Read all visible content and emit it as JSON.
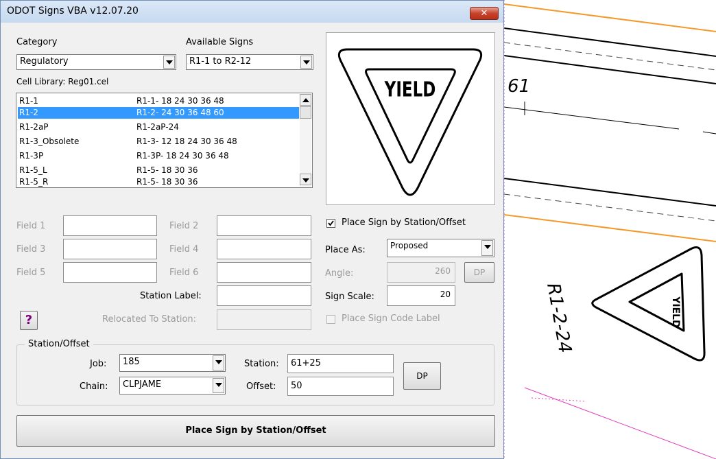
{
  "window": {
    "title": "ODOT Signs VBA  v12.07.20",
    "close_label": "✕"
  },
  "category": {
    "label": "Category",
    "value": "Regulatory"
  },
  "available_signs": {
    "label": "Available Signs",
    "value": "R1-1 to R2-12"
  },
  "cell_library": "Cell Library:  Reg01.cel",
  "sign_list": [
    {
      "code": "R1-1",
      "sizes": "R1-1- 18 24 30 36 48",
      "selected": false
    },
    {
      "code": "R1-2",
      "sizes": "R1-2- 24 30 36 48 60",
      "selected": true
    },
    {
      "code": "R1-2aP",
      "sizes": "R1-2aP-24",
      "selected": false
    },
    {
      "code": "R1-3_Obsolete",
      "sizes": "R1-3- 12 18 24 30 36 48",
      "selected": false
    },
    {
      "code": "R1-3P",
      "sizes": "R1-3P- 18 24 30 36 48",
      "selected": false
    },
    {
      "code": "R1-5_L",
      "sizes": "R1-5- 18 30 36",
      "selected": false
    },
    {
      "code": "R1-5_R",
      "sizes": "R1-5- 18 30 36",
      "selected": false
    }
  ],
  "preview": {
    "sign_text": "YIELD"
  },
  "fields": {
    "field1": "Field 1",
    "field2": "Field 2",
    "field3": "Field 3",
    "field4": "Field 4",
    "field5": "Field 5",
    "field6": "Field 6",
    "station_label": "Station Label:",
    "relocated_label": "Relocated To Station:",
    "help_label": "?"
  },
  "placement": {
    "place_by_station_label": "Place Sign by Station/Offset",
    "place_by_station_checked": true,
    "place_as_label": "Place As:",
    "place_as_value": "Proposed",
    "angle_label": "Angle:",
    "angle_value": "260",
    "dp_label": "DP",
    "sign_scale_label": "Sign Scale:",
    "sign_scale_value": "20",
    "code_label_text": "Place Sign Code Label",
    "code_label_checked": false
  },
  "station_offset": {
    "legend": "Station/Offset",
    "job_label": "Job:",
    "job_value": "185",
    "chain_label": "Chain:",
    "chain_value": "CLPJAME",
    "station_label": "Station:",
    "station_value": "61+25",
    "offset_label": "Offset:",
    "offset_value": "50",
    "dp_label": "DP"
  },
  "main_button": "Place Sign by Station/Offset",
  "cad": {
    "station_text": "61",
    "sign_label": "R1-2-24",
    "sign_text": "YIELD"
  },
  "colors": {
    "selection": "#3399ff",
    "cad_orange": "#f39a2b",
    "cad_magenta": "#e040c0",
    "help_purple": "#800080"
  }
}
